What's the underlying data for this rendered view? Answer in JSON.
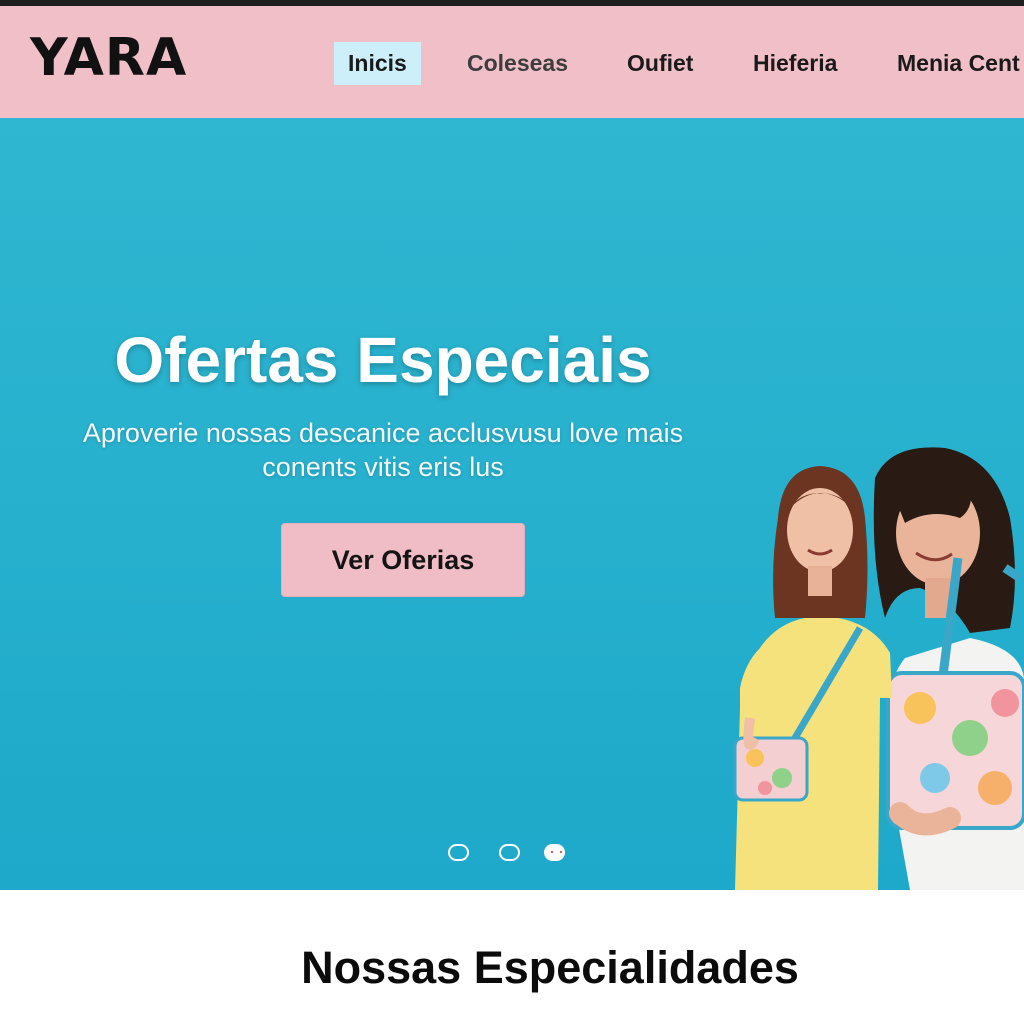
{
  "brand": {
    "logo_text": "YARA"
  },
  "nav": {
    "items": [
      {
        "label": "Inicis"
      },
      {
        "label": "Coleseas"
      },
      {
        "label": "Oufiet"
      },
      {
        "label": "Hieferia"
      },
      {
        "label": "Menia Cent"
      }
    ]
  },
  "hero": {
    "title": "Ofertas Especiais",
    "subtitle_line1": "Aproverie nossas descanice acclusvusu love mais",
    "subtitle_line2": "conents vitis eris lus",
    "cta_label": "Ver Oferias",
    "carousel": {
      "slide_count": 3,
      "active_index": 2
    }
  },
  "section": {
    "title": "Nossas Especialidades"
  },
  "colors": {
    "header_bg": "#f0bfc8",
    "active_nav_bg": "#cdeffa",
    "hero_bg": "#26b0ce",
    "cta_bg": "#f0bcc6"
  },
  "icons": [
    "carousel-dot-icon"
  ]
}
